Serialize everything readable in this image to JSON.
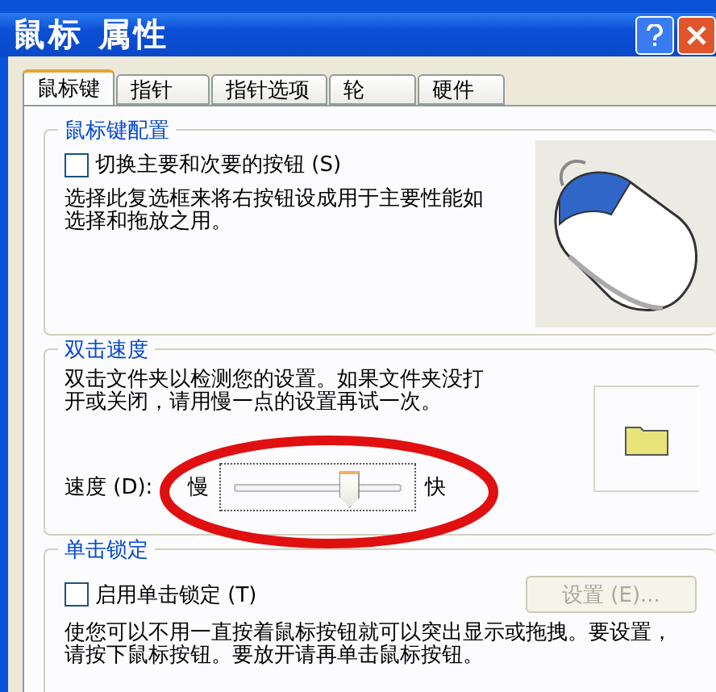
{
  "window": {
    "title": "鼠标 属性"
  },
  "tabs": [
    {
      "label": "鼠标键",
      "selected": true
    },
    {
      "label": "指针",
      "selected": false
    },
    {
      "label": "指针选项",
      "selected": false
    },
    {
      "label": "轮",
      "selected": false
    },
    {
      "label": "硬件",
      "selected": false
    }
  ],
  "button_config": {
    "legend": "鼠标键配置",
    "checkbox": {
      "label": "切换主要和次要的按钮 (S)",
      "checked": false
    },
    "description": "选择此复选框来将右按钮设成用于主要性能如选择和拖放之用。"
  },
  "double_click": {
    "legend": "双击速度",
    "description": "双击文件夹以检测您的设置。如果文件夹没打开或关闭，请用慢一点的设置再试一次。",
    "speed_label": "速度 (D):",
    "slow_label": "慢",
    "fast_label": "快",
    "level": 0.68,
    "highlighted": true
  },
  "click_lock": {
    "legend": "单击锁定",
    "checkbox": {
      "label": "启用单击锁定 (T)",
      "checked": false
    },
    "settings_button": {
      "label": "设置 (E)...",
      "disabled": true
    },
    "description": "使您可以不用一直按着鼠标按钮就可以突出显示或拖拽。要设置，请按下鼠标按钮。要放开请再单击鼠标按钮。"
  }
}
